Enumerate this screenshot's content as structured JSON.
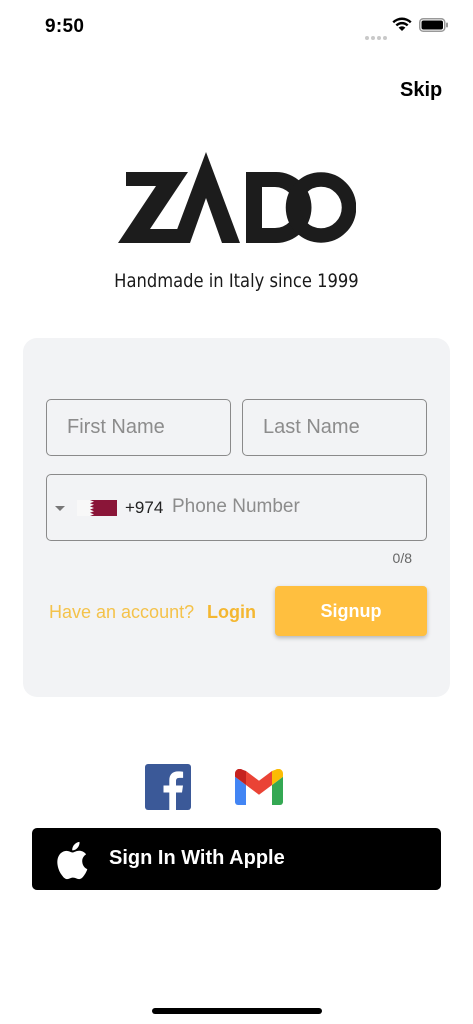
{
  "status": {
    "time": "9:50"
  },
  "header": {
    "skip_label": "Skip"
  },
  "brand": {
    "logo_text": "ZADO",
    "tagline": "Handmade in Italy since 1999"
  },
  "form": {
    "first_name": {
      "placeholder": "First Name",
      "value": ""
    },
    "last_name": {
      "placeholder": "Last Name",
      "value": ""
    },
    "phone": {
      "dial_code": "+974",
      "placeholder": "Phone Number",
      "value": "",
      "counter": "0/8",
      "country_flag": "qatar-flag"
    },
    "have_account_text": "Have an account?",
    "login_label": "Login",
    "signup_label": "Signup"
  },
  "social": {
    "facebook_icon": "facebook-icon",
    "gmail_icon": "gmail-icon"
  },
  "apple_button": {
    "label": "Sign In With Apple",
    "icon": "apple-icon"
  },
  "colors": {
    "accent": "#ffbf3f",
    "link": "#f4b731",
    "card_bg": "#f2f3f5",
    "apple_bg": "#000000",
    "facebook": "#3b5998"
  }
}
